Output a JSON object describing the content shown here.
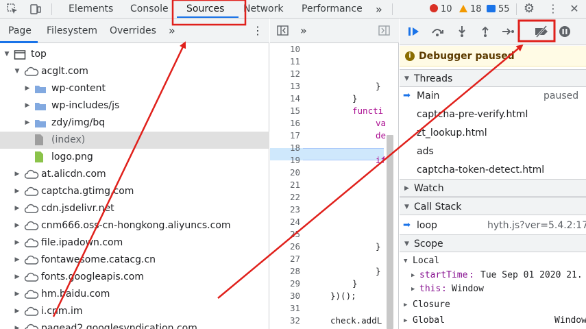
{
  "toolbar": {
    "tabs": [
      "Elements",
      "Console",
      "Sources",
      "Network",
      "Performance"
    ],
    "more": "»",
    "errors": "10",
    "warnings": "18",
    "infos": "55",
    "active_tab": "Sources",
    "accent": "#1a73e8"
  },
  "navigator": {
    "tabs": [
      "Page",
      "Filesystem",
      "Overrides"
    ],
    "more": "»",
    "tree": [
      {
        "label": "top",
        "depth": 0,
        "icon": "frame-icon",
        "expanded": true
      },
      {
        "label": "acglt.com",
        "depth": 1,
        "icon": "cloud-icon",
        "expanded": true
      },
      {
        "label": "wp-content",
        "depth": 2,
        "icon": "folder-icon",
        "expanded": false
      },
      {
        "label": "wp-includes/js",
        "depth": 2,
        "icon": "folder-icon",
        "expanded": false
      },
      {
        "label": "zdy/img/bq",
        "depth": 2,
        "icon": "folder-icon",
        "expanded": false
      },
      {
        "label": "(index)",
        "depth": 2,
        "icon": "file-icon",
        "selected": true
      },
      {
        "label": "logo.png",
        "depth": 2,
        "icon": "image-file-icon"
      },
      {
        "label": "at.alicdn.com",
        "depth": 1,
        "icon": "cloud-icon",
        "expanded": false
      },
      {
        "label": "captcha.gtimg.com",
        "depth": 1,
        "icon": "cloud-icon",
        "expanded": false
      },
      {
        "label": "cdn.jsdelivr.net",
        "depth": 1,
        "icon": "cloud-icon",
        "expanded": false
      },
      {
        "label": "cnm666.oss-cn-hongkong.aliyuncs.com",
        "depth": 1,
        "icon": "cloud-icon",
        "expanded": false
      },
      {
        "label": "file.ipadown.com",
        "depth": 1,
        "icon": "cloud-icon",
        "expanded": false
      },
      {
        "label": "fontawesome.catacg.cn",
        "depth": 1,
        "icon": "cloud-icon",
        "expanded": false
      },
      {
        "label": "fonts.googleapis.com",
        "depth": 1,
        "icon": "cloud-icon",
        "expanded": false
      },
      {
        "label": "hm.baidu.com",
        "depth": 1,
        "icon": "cloud-icon",
        "expanded": false
      },
      {
        "label": "i.cnm.im",
        "depth": 1,
        "icon": "cloud-icon",
        "expanded": false
      },
      {
        "label": "pagead2.googlesyndication.com",
        "depth": 1,
        "icon": "cloud-icon",
        "expanded": false
      }
    ]
  },
  "editor": {
    "more": "»",
    "line_numbers": [
      "10",
      "11",
      "12",
      "13",
      "14",
      "15",
      "16",
      "17",
      "18",
      "19",
      "20",
      "21",
      "22",
      "23",
      "24",
      "25",
      "26",
      "27",
      "28",
      "29",
      "30",
      "31",
      "32"
    ],
    "highlighted_line": "17",
    "code_lines": [
      {
        "line": "13",
        "text": "}"
      },
      {
        "line": "14",
        "text": "}"
      },
      {
        "line": "15",
        "text": "functi",
        "kw": true
      },
      {
        "line": "16",
        "text": "va",
        "kw": true
      },
      {
        "line": "17",
        "text": "de",
        "kw": true
      },
      {
        "line": "19",
        "text": "if",
        "kw": true
      },
      {
        "line": "26",
        "text": "}"
      },
      {
        "line": "28",
        "text": "}"
      },
      {
        "line": "29",
        "text": "}"
      },
      {
        "line": "30",
        "text": "})();"
      },
      {
        "line": "32",
        "text": "check.addL"
      }
    ]
  },
  "debugger": {
    "paused_text": "Debugger paused",
    "threads_title": "Threads",
    "threads": [
      {
        "name": "Main",
        "status": "paused",
        "current": true
      },
      {
        "name": "captcha-pre-verify.html"
      },
      {
        "name": "zt_lookup.html"
      },
      {
        "name": "ads"
      },
      {
        "name": "captcha-token-detect.html"
      }
    ],
    "watch_title": "Watch",
    "callstack_title": "Call Stack",
    "callstack": [
      {
        "fn": "loop",
        "location": "hyth.js?ver=5.4.2:17"
      }
    ],
    "scope_title": "Scope",
    "scope_local": "Local",
    "scope_vars": [
      {
        "name": "startTime",
        "value": "Tue Sep 01 2020 21."
      },
      {
        "name": "this",
        "value": "Window"
      }
    ],
    "scope_closure": "Closure",
    "scope_global": "Global",
    "scope_global_value": "Window"
  },
  "annotation_color": "#e0201b"
}
